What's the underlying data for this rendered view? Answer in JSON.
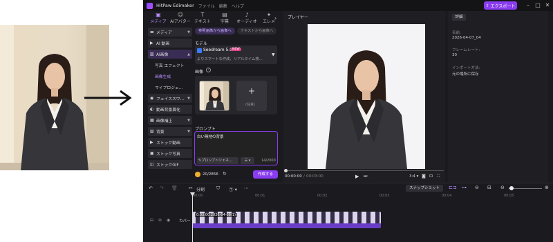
{
  "app": {
    "name": "HitPaw Edimakor",
    "menu": [
      "ファイル",
      "編集",
      "ヘルプ"
    ],
    "export_label": "エクスポート",
    "accent": "#8a3cf0"
  },
  "tabs": [
    {
      "label": "メディア",
      "icon": "media-icon",
      "active": true
    },
    {
      "label": "AIアバター",
      "icon": "avatar-icon"
    },
    {
      "label": "テキスト",
      "icon": "text-icon"
    },
    {
      "label": "字幕",
      "icon": "subtitle-icon"
    },
    {
      "label": "オーディオ",
      "icon": "audio-icon"
    },
    {
      "label": "エレメ",
      "icon": "element-icon"
    }
  ],
  "sidebar": {
    "items": [
      {
        "label": "メディア"
      },
      {
        "label": "AI 動画"
      },
      {
        "label": "AI画像"
      },
      {
        "label": "写真 エフェクト",
        "sub": true
      },
      {
        "label": "画像生成",
        "sub": true,
        "selected": true
      },
      {
        "label": "マイプロジェ...",
        "sub": true
      },
      {
        "label": "フェイススワ..."
      },
      {
        "label": "動画背景異化"
      },
      {
        "label": "画像補正"
      },
      {
        "label": "背景"
      },
      {
        "label": "ストック動画"
      },
      {
        "label": "ストック写真"
      },
      {
        "label": "ストックGIF"
      }
    ]
  },
  "generator": {
    "subtabs": [
      "参照画像から画像へ",
      "テキストから画像へ"
    ],
    "model_label": "モデル",
    "model_name": "Seedream 5.0",
    "model_badge": "NEW",
    "model_desc": "よりスマートな作成、リアルタイム検...",
    "image_label": "画像",
    "upload_hint": "(任意)",
    "prompt_label": "プロンプト",
    "prompt_text": "白い無地の背景",
    "prompt_gen_label": "プロンプトジェネ...",
    "char_count": "14/2000",
    "credits": "20/2856",
    "generate_label": "作成する"
  },
  "player": {
    "title": "プレイヤー",
    "time": "00:00:00",
    "duration": "00:03:00",
    "ratio": "3:4"
  },
  "details": {
    "tab": "詳細",
    "fields": [
      {
        "label": "名前:",
        "value": "2026-04-07_04"
      },
      {
        "label": "フレームレート:",
        "value": "30"
      },
      {
        "label": "インポート方法:",
        "value": "元の場所に保存"
      }
    ]
  },
  "timeline": {
    "split_label": "分割",
    "snapshot_label": "スナップショット",
    "ruler": [
      "00:00",
      "00:01",
      "00:02",
      "00:03",
      "00:04",
      "00:05"
    ],
    "track_label": "カバー",
    "clip_text": "0:03:00 2026-04-08(1)"
  }
}
